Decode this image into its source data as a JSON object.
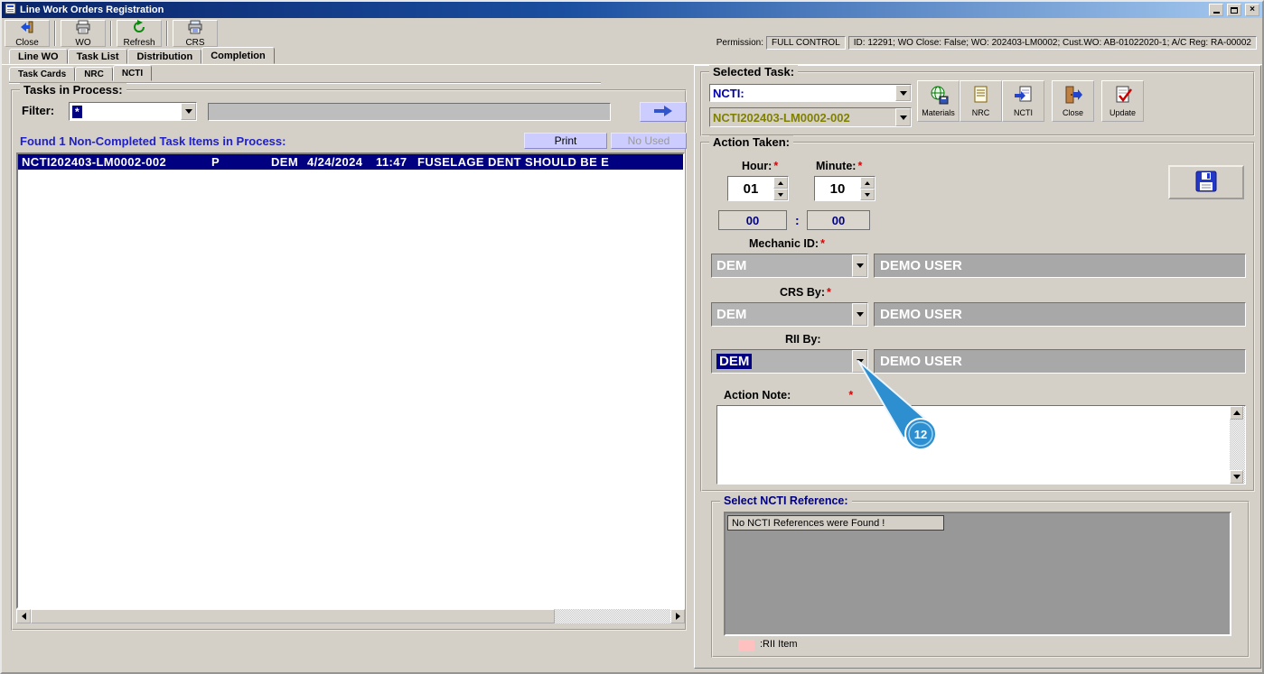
{
  "window": {
    "title": "Line Work Orders Registration"
  },
  "toolbar": {
    "buttons": [
      {
        "label": "Close",
        "icon": "exit-icon"
      },
      {
        "label": "WO",
        "icon": "printer-icon"
      },
      {
        "label": "Refresh",
        "icon": "refresh-icon"
      },
      {
        "label": "CRS",
        "icon": "printer-doc-icon"
      }
    ],
    "permission_label": "Permission:",
    "permission_value": "FULL CONTROL",
    "record_info": "ID: 12291; WO Close: False; WO: 202403-LM0002; Cust.WO: AB-01022020-1; A/C Reg: RA-00002"
  },
  "tabs": {
    "main": [
      {
        "label": "Line WO"
      },
      {
        "label": "Task List"
      },
      {
        "label": "Distribution"
      },
      {
        "label": "Completion"
      }
    ],
    "sub": [
      {
        "label": "Task Cards"
      },
      {
        "label": "NRC"
      },
      {
        "label": "NCTI"
      }
    ]
  },
  "tasks_in_process": {
    "legend": "Tasks in Process:",
    "filter_label": "Filter:",
    "filter_value": "*",
    "filter_input_value": "",
    "found_text": "Found 1 Non-Completed Task Items in Process:",
    "print_button": "Print",
    "no_used_button": "No Used",
    "task_row": {
      "id": "NCTI202403-LM0002-002",
      "status": "P",
      "mechanic": "DEM",
      "date": "4/24/2024",
      "time": "11:47",
      "description": "FUSELAGE DENT SHOULD BE E"
    }
  },
  "selected_task": {
    "legend": "Selected Task:",
    "type_value": "NCTI:",
    "task_id": "NCTI202403-LM0002-002",
    "buttons": [
      {
        "label": "Materials",
        "icon": "globe-disk-icon"
      },
      {
        "label": "NRC",
        "icon": "document-icon"
      },
      {
        "label": "NCTI",
        "icon": "document-arrow-icon"
      },
      {
        "label": "Close",
        "icon": "door-exit-icon"
      },
      {
        "label": "Update",
        "icon": "check-document-icon"
      }
    ]
  },
  "action_taken": {
    "legend": "Action Taken:",
    "required_marker": "*",
    "hour_label": "Hour:",
    "hour_value": "01",
    "minute_label": "Minute:",
    "minute_value": "10",
    "elapsed_hour": "00",
    "elapsed_separator": ":",
    "elapsed_minute": "00",
    "mechanic_label": "Mechanic ID:",
    "mechanic_value": "DEM",
    "mechanic_name": "DEMO USER",
    "crs_label": "CRS By:",
    "crs_value": "DEM",
    "crs_name": "DEMO USER",
    "rii_label": "RII By:",
    "rii_value": "DEM",
    "rii_name": "DEMO USER",
    "note_label": "Action Note:",
    "note_value": ""
  },
  "ncti_reference": {
    "legend": "Select NCTI Reference:",
    "empty_message": "No NCTI References were Found !",
    "rii_legend": ":RII Item"
  },
  "annotation": {
    "step_number": "12"
  },
  "colors": {
    "selection_navy": "#000080",
    "annotation_blue": "#2E8FD0",
    "rii_pink": "#FFC0C0",
    "button_lavender": "#CCCCFF",
    "found_text_blue": "#2020C8",
    "task_olive": "#808000"
  }
}
